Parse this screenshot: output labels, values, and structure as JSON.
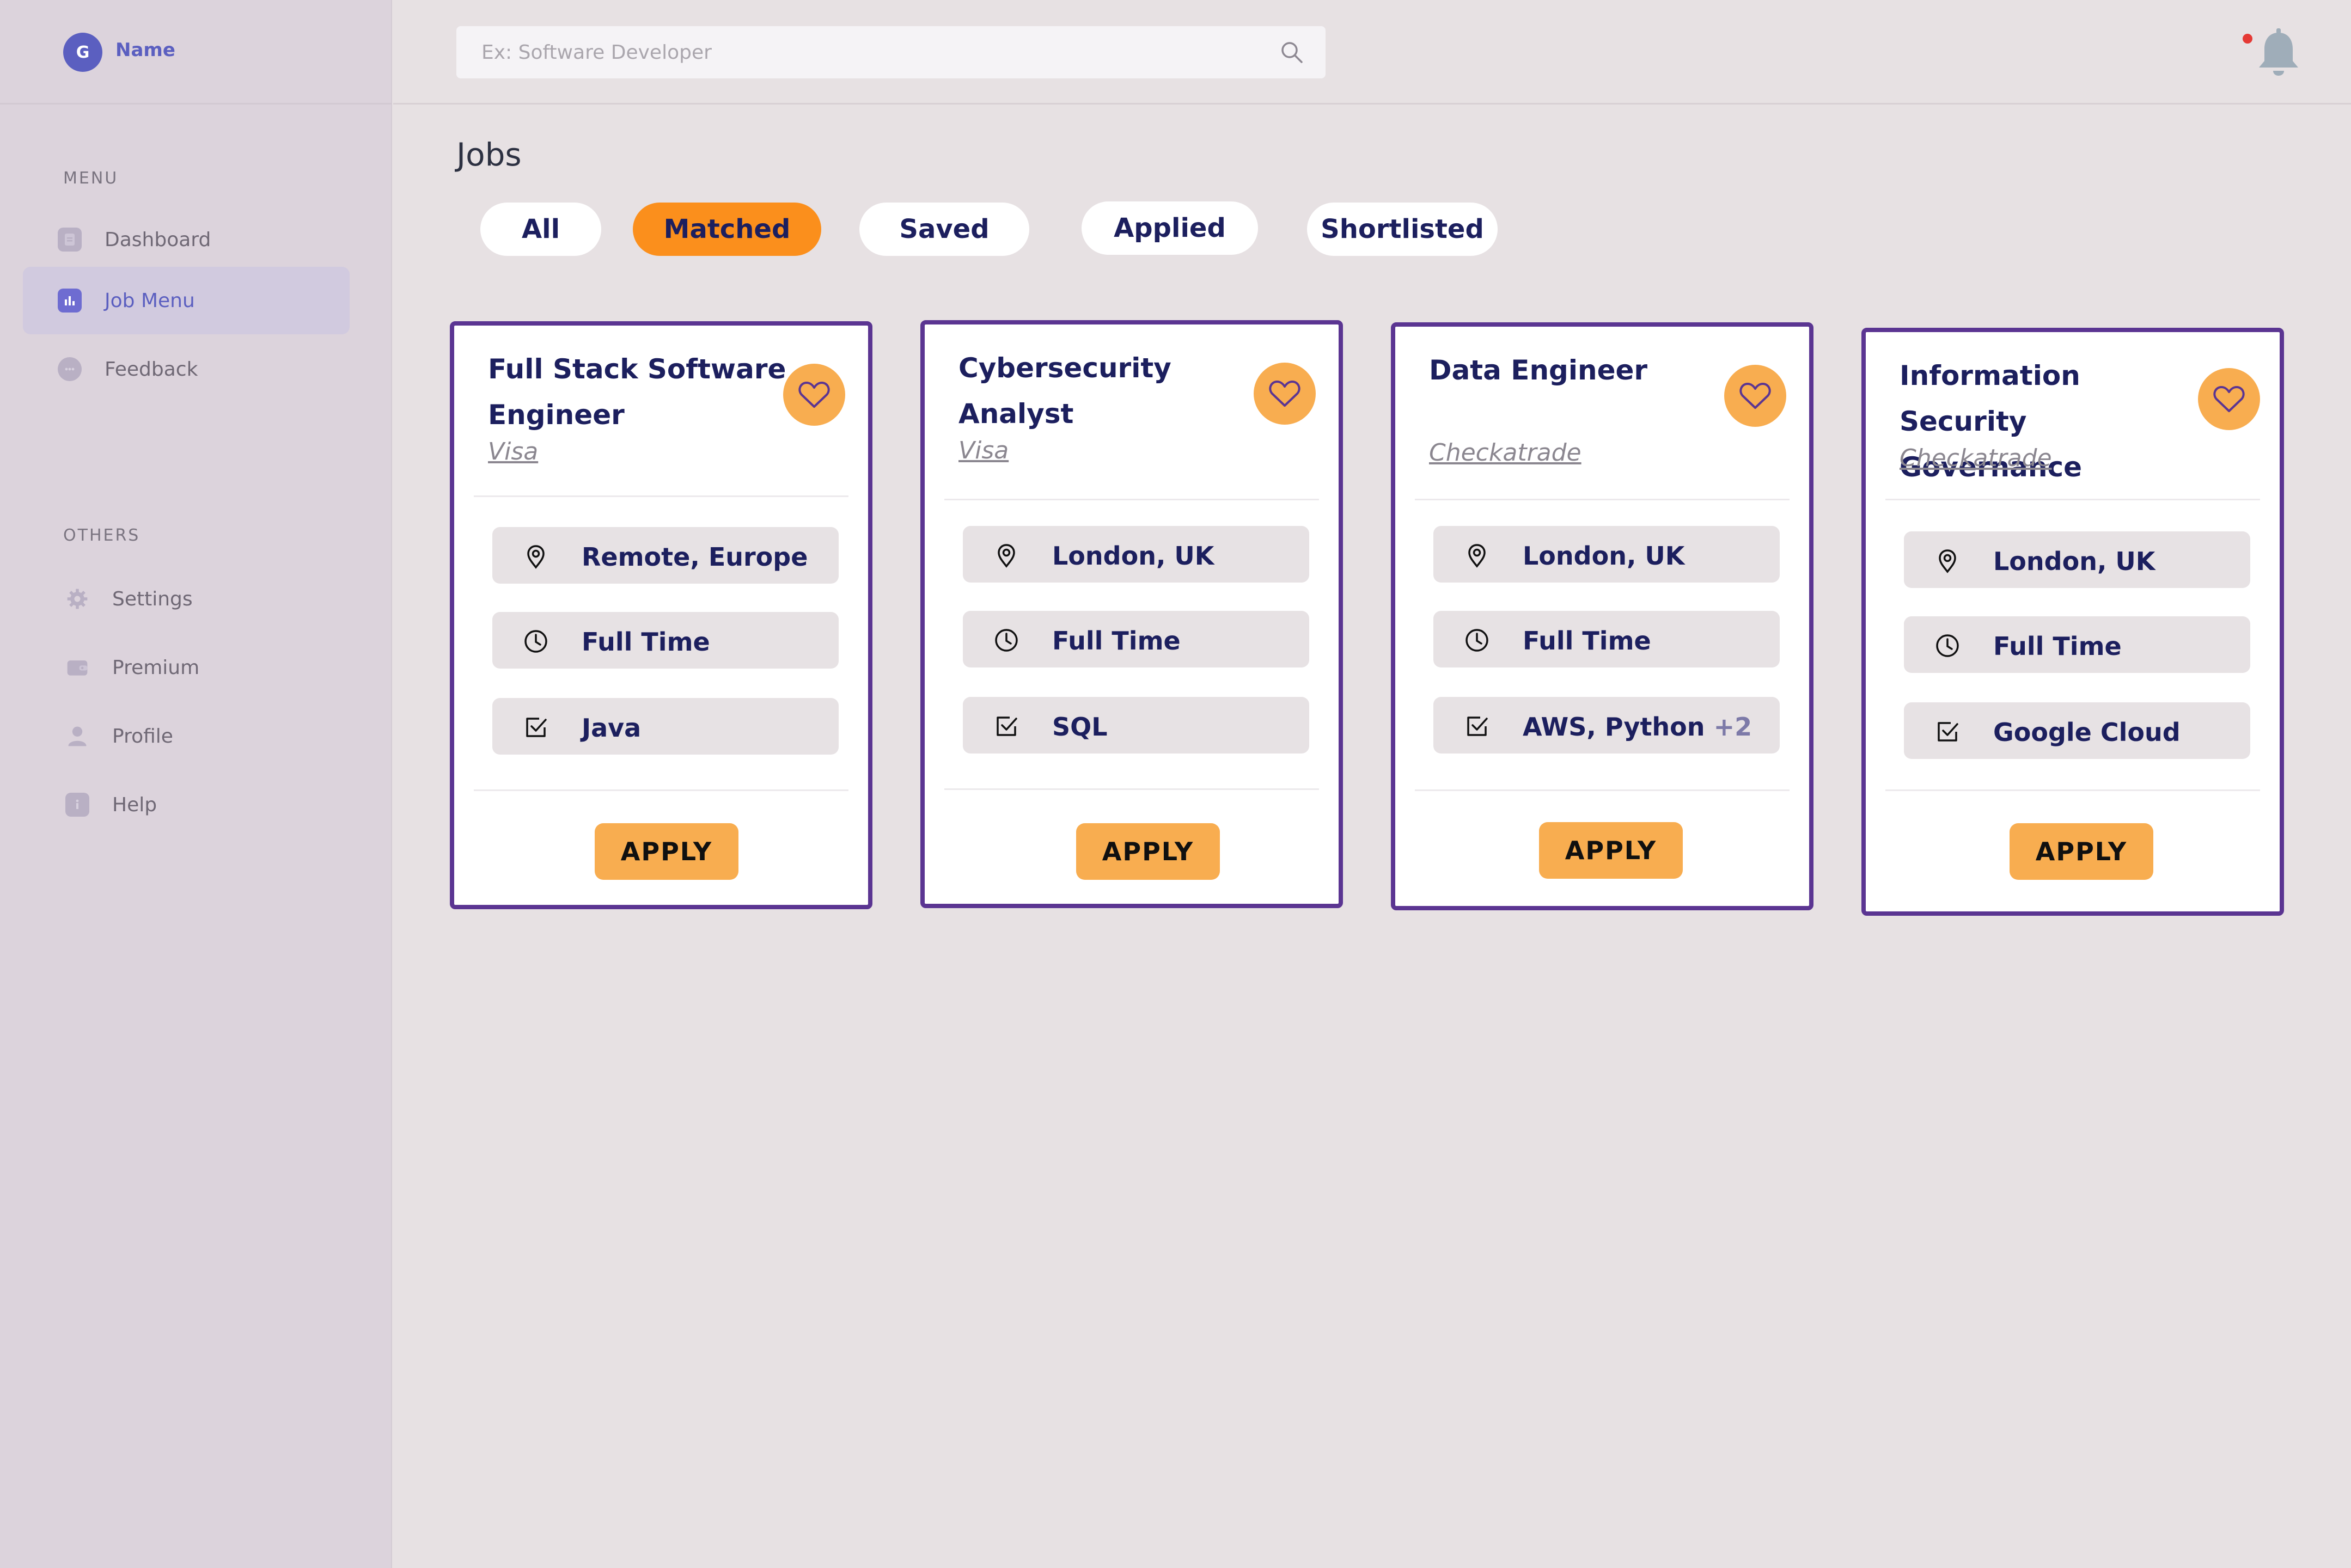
{
  "user": {
    "initial": "G",
    "name": "Name"
  },
  "sidebar": {
    "menu_label": "MENU",
    "menu_items": [
      {
        "label": "Dashboard",
        "icon": "document-icon",
        "active": false
      },
      {
        "label": "Job Menu",
        "icon": "bar-chart-icon",
        "active": true
      },
      {
        "label": "Feedback",
        "icon": "chat-icon",
        "active": false
      }
    ],
    "others_label": "OTHERS",
    "other_items": [
      {
        "label": "Settings",
        "icon": "gear-icon"
      },
      {
        "label": "Premium",
        "icon": "wallet-icon"
      },
      {
        "label": "Profile",
        "icon": "user-icon"
      },
      {
        "label": "Help",
        "icon": "info-icon"
      }
    ]
  },
  "search": {
    "placeholder": "Ex: Software Developer",
    "value": ""
  },
  "notifications": {
    "has_unread": true,
    "dot_color": "#e53935"
  },
  "page": {
    "title": "Jobs"
  },
  "filters": [
    {
      "label": "All",
      "active": false
    },
    {
      "label": "Matched",
      "active": true
    },
    {
      "label": "Saved",
      "active": false
    },
    {
      "label": "Applied",
      "active": false
    },
    {
      "label": "Shortlisted",
      "active": false
    }
  ],
  "jobs": [
    {
      "title": "Full Stack Software Engineer",
      "company": "Visa",
      "location": "Remote, Europe",
      "type": "Full Time",
      "skills": "Java",
      "skills_more": "",
      "apply_label": "APPLY"
    },
    {
      "title": "Cybersecurity Analyst",
      "company": "Visa",
      "location": "London, UK",
      "type": "Full Time",
      "skills": "SQL",
      "skills_more": "",
      "apply_label": "APPLY"
    },
    {
      "title": "Data Engineer",
      "company": "Checkatrade",
      "location": "London, UK",
      "type": "Full Time",
      "skills": "AWS, Python",
      "skills_more": "+2",
      "apply_label": "APPLY"
    },
    {
      "title": "Information Security Governance",
      "company": "Checkatrade",
      "location": "London, UK",
      "type": "Full Time",
      "skills": "Google Cloud",
      "skills_more": "",
      "apply_label": "APPLY"
    }
  ],
  "colors": {
    "accent_orange": "#fb8f1c",
    "button_orange": "#f8ad50",
    "card_border": "#5b3592",
    "text_navy": "#1c1f5e",
    "brand_blue": "#5b5fc0"
  }
}
